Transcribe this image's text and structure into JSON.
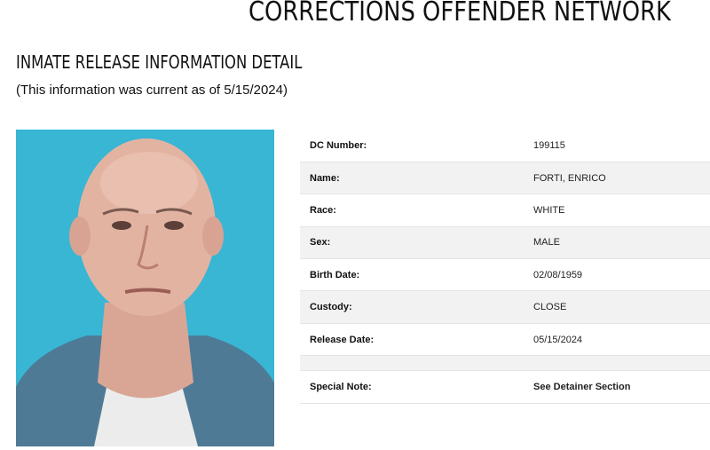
{
  "header": {
    "site_title": "CORRECTIONS OFFENDER NETWORK"
  },
  "section": {
    "title": "INMATE RELEASE INFORMATION DETAIL",
    "current_note": "(This information was current as of 5/15/2024)"
  },
  "details": {
    "dc_number": {
      "label": "DC Number:",
      "value": "199115"
    },
    "name": {
      "label": "Name:",
      "value": "FORTI, ENRICO"
    },
    "race": {
      "label": "Race:",
      "value": "WHITE"
    },
    "sex": {
      "label": "Sex:",
      "value": "MALE"
    },
    "birth_date": {
      "label": "Birth Date:",
      "value": "02/08/1959"
    },
    "custody": {
      "label": "Custody:",
      "value": "CLOSE"
    },
    "release_date": {
      "label": "Release Date:",
      "value": "05/15/2024"
    },
    "special_note": {
      "label": "Special Note:",
      "value": "See Detainer Section"
    }
  },
  "colors": {
    "photo_background": "#38b6d4",
    "row_alt": "#f2f2f2",
    "shirt": "#4f7a96"
  }
}
